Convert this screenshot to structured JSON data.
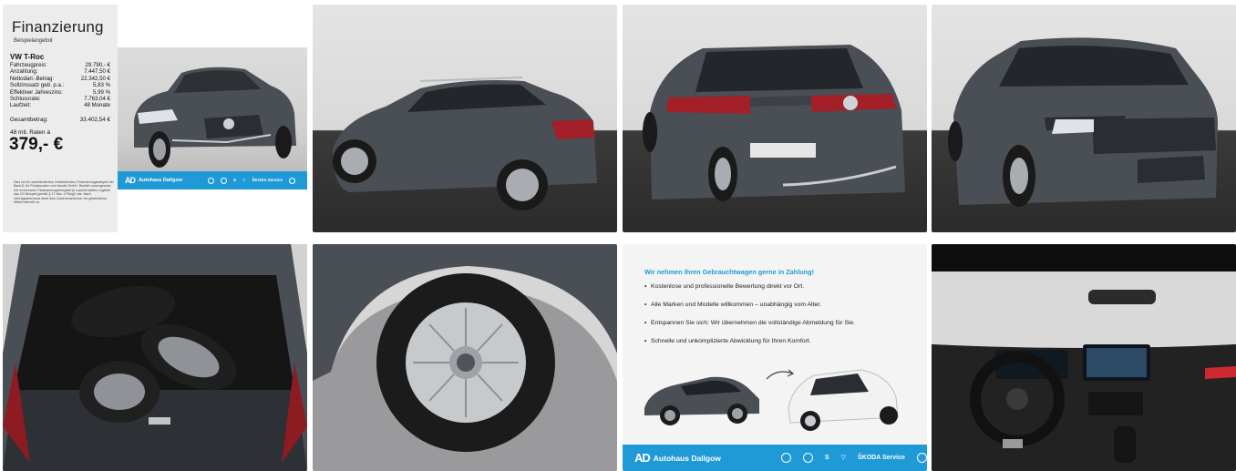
{
  "financing": {
    "title": "Finanzierung",
    "subtitle": "Beispielangebot",
    "model": "VW T-Roc",
    "rows": [
      {
        "label": "Fahrzeugpreis:",
        "value": "29.790,- €"
      },
      {
        "label": "Anzahlung:",
        "value": "7.447,50 €"
      },
      {
        "label": "Nettodarl.-Betrag:",
        "value": "22.342,50 €"
      },
      {
        "label": "Sollzinssatz geb. p.a.:",
        "value": "5,83 %"
      },
      {
        "label": "Effektiver Jahreszins:",
        "value": "5,99 %"
      },
      {
        "label": "Schlussrate:",
        "value": "7.763,04 €"
      },
      {
        "label": "Laufzeit:",
        "value": "48 Monate"
      }
    ],
    "total_label": "Gesamtbetrag:",
    "total_value": "33.402,54 €",
    "installments_label": "48 mtl. Raten à",
    "monthly_rate": "379,- €",
    "fineprint": "Dies ist ein unverbindliches, freibleibendes Finanzierungsbeispiel der Bank11 für Privatkunden und Handel GmbH. Bonität vorausgesetzt. Die errechneten Finanzierungsbeispiele je Laufzeit stellen zugleich das 2/3 Beispiel gemäß § 17 Abs. 4 PAngV dar. Nach Vertragsabschluss steht dem Darlehensnehmer ein gesetzliches Widerrufsrecht zu."
  },
  "dealer": {
    "logo_mark": "AD",
    "name": "Autohaus Dallgow",
    "brands": [
      "VW",
      "Nutzfahrzeuge",
      "SEAT",
      "CUPRA",
      "ŠKODA Service",
      "VW Service"
    ]
  },
  "tradein": {
    "headline": "Wir nehmen Ihren Gebrauchtwagen gerne in Zahlung!",
    "items": [
      "Kostenlose und professionelle Bewertung direkt vor Ort.",
      "Alle Marken und Modelle willkommen – unabhängig vom Alter.",
      "Entspannen Sie sich: Wir übernehmen die vollständige Abmeldung für Sie.",
      "Schnelle und unkomplizierte Abwicklung für Ihren Komfort."
    ]
  },
  "colors": {
    "dealer_blue": "#1f9ad6",
    "car_gray": "#4a4e55",
    "studio_floor": "#2b2b2b"
  }
}
